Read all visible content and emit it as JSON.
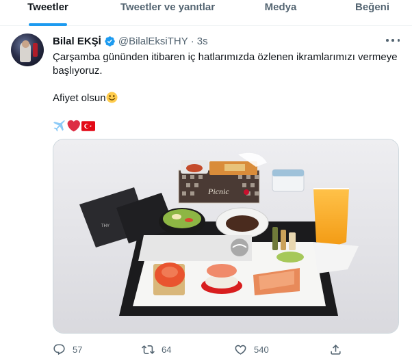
{
  "tabs": [
    {
      "label": "Tweetler",
      "active": true
    },
    {
      "label": "Tweetler ve yanıtlar",
      "active": false
    },
    {
      "label": "Medya",
      "active": false
    },
    {
      "label": "Beğeni",
      "active": false
    }
  ],
  "tweet": {
    "author_name": "Bilal EKŞİ",
    "handle": "@BilalEksiTHY",
    "separator": "·",
    "time": "3s",
    "text_line1": "Çarşamba gününden itibaren  iç hatlarımızda özlenen ikramlarımızı vermeye başlıyoruz.",
    "text_line2": "Afiyet olsun",
    "emojis": [
      "airplane",
      "red-heart",
      "turkey-flag"
    ],
    "media": {
      "brand_text": "Picnic",
      "card_text": "TURKISH AIRLINES"
    },
    "actions": {
      "replies": "57",
      "retweets": "64",
      "likes": "540"
    }
  },
  "colors": {
    "accent": "#1d9bf0",
    "secondary_text": "#536471",
    "primary_text": "#0f1419"
  }
}
